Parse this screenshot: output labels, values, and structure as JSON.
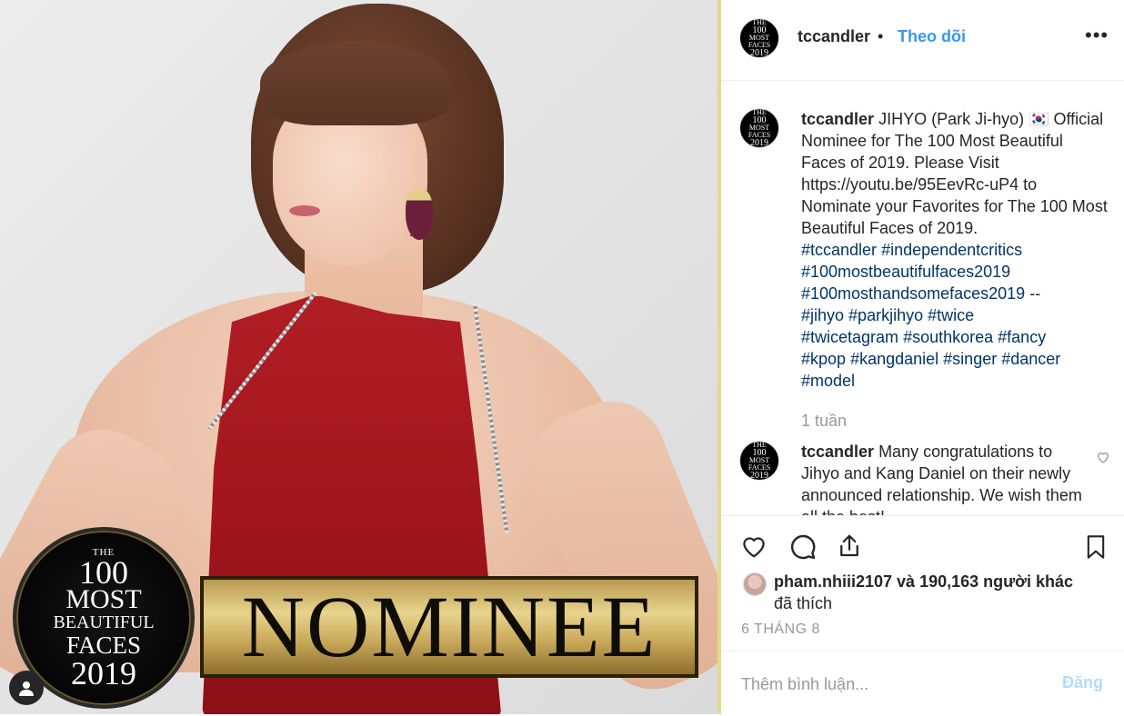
{
  "image": {
    "seal": {
      "line1": "THE",
      "line2": "100",
      "line3": "MOST",
      "line4": "BEAUTIFUL",
      "line5": "FACES",
      "line6": "2019"
    },
    "banner_text": "NOMINEE"
  },
  "header": {
    "avatar": {
      "l1": "THE",
      "l2": "100",
      "l3": "MOST",
      "l4": "FACES",
      "l5": "2019"
    },
    "username": "tccandler",
    "separator": "•",
    "follow_label": "Theo dõi",
    "more_label": "•••"
  },
  "caption": {
    "username": "tccandler",
    "text": "JIHYO (Park Ji-hyo) 🇰🇷 Official Nominee for The 100 Most Beautiful Faces of 2019. Please Visit https://youtu.be/95EevRc-uP4 to Nominate your Favorites for The 100 Most Beautiful Faces of 2019.",
    "tags": [
      "#tccandler",
      "#independentcritics",
      "#100mostbeautifulfaces2019",
      "#100mosthandsomefaces2019",
      "--",
      "#jihyo",
      "#parkjihyo",
      "#twice",
      "#twicetagram",
      "#southkorea",
      "#fancy",
      "#kpop",
      "#kangdaniel",
      "#singer",
      "#dancer",
      "#model"
    ],
    "time": "1 tuần"
  },
  "comment": {
    "username": "tccandler",
    "text": "Many congratulations to Jihyo and Kang Daniel on their newly announced relationship. We wish them all the best!"
  },
  "likes": {
    "user": "pham.nhiii2107",
    "rest": " và 190,163 người khác",
    "line2": "đã thích"
  },
  "date": "6 THÁNG 8",
  "add_comment": {
    "placeholder": "Thêm bình luận...",
    "post_label": "Đăng"
  }
}
